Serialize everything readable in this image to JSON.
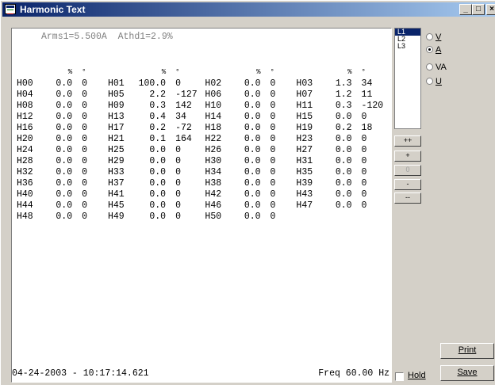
{
  "window": {
    "title": "Harmonic Text"
  },
  "header": {
    "line": "Arms1=5.500A  Athd1=2.9%"
  },
  "table": {
    "headers": [
      "",
      "%",
      "°",
      "",
      "%",
      "°",
      "",
      "%",
      "°",
      "",
      "%",
      "°"
    ],
    "rows": [
      [
        "H00",
        "0.0",
        "0",
        "H01",
        "100.0",
        "0",
        "H02",
        "0.0",
        "0",
        "H03",
        "1.3",
        "34"
      ],
      [
        "H04",
        "0.0",
        "0",
        "H05",
        "2.2",
        "-127",
        "H06",
        "0.0",
        "0",
        "H07",
        "1.2",
        "11"
      ],
      [
        "H08",
        "0.0",
        "0",
        "H09",
        "0.3",
        "142",
        "H10",
        "0.0",
        "0",
        "H11",
        "0.3",
        "-120"
      ],
      [
        "H12",
        "0.0",
        "0",
        "H13",
        "0.4",
        "34",
        "H14",
        "0.0",
        "0",
        "H15",
        "0.0",
        "0"
      ],
      [
        "H16",
        "0.0",
        "0",
        "H17",
        "0.2",
        "-72",
        "H18",
        "0.0",
        "0",
        "H19",
        "0.2",
        "18"
      ],
      [
        "H20",
        "0.0",
        "0",
        "H21",
        "0.1",
        "164",
        "H22",
        "0.0",
        "0",
        "H23",
        "0.0",
        "0"
      ],
      [
        "H24",
        "0.0",
        "0",
        "H25",
        "0.0",
        "0",
        "H26",
        "0.0",
        "0",
        "H27",
        "0.0",
        "0"
      ],
      [
        "H28",
        "0.0",
        "0",
        "H29",
        "0.0",
        "0",
        "H30",
        "0.0",
        "0",
        "H31",
        "0.0",
        "0"
      ],
      [
        "H32",
        "0.0",
        "0",
        "H33",
        "0.0",
        "0",
        "H34",
        "0.0",
        "0",
        "H35",
        "0.0",
        "0"
      ],
      [
        "H36",
        "0.0",
        "0",
        "H37",
        "0.0",
        "0",
        "H38",
        "0.0",
        "0",
        "H39",
        "0.0",
        "0"
      ],
      [
        "H40",
        "0.0",
        "0",
        "H41",
        "0.0",
        "0",
        "H42",
        "0.0",
        "0",
        "H43",
        "0.0",
        "0"
      ],
      [
        "H44",
        "0.0",
        "0",
        "H45",
        "0.0",
        "0",
        "H46",
        "0.0",
        "0",
        "H47",
        "0.0",
        "0"
      ],
      [
        "H48",
        "0.0",
        "0",
        "H49",
        "0.0",
        "0",
        "H50",
        "0.0",
        "0",
        "",
        "",
        ""
      ]
    ]
  },
  "footer": {
    "timestamp": "04-24-2003 - 10:17:14.621",
    "freq": "Freq 60.00 Hz"
  },
  "phases": {
    "items": [
      "L1",
      "L2",
      "L3"
    ],
    "selected": "L1"
  },
  "units": {
    "options": [
      "V",
      "A",
      "VA",
      "U"
    ],
    "selected": "A"
  },
  "scale_buttons": [
    "++",
    "+",
    "0",
    "-",
    "--"
  ],
  "buttons": {
    "print": "Print",
    "save": "Save",
    "hold": "Hold"
  },
  "titlebar_buttons": {
    "minimize": "_",
    "maximize": "□",
    "close": "×"
  }
}
